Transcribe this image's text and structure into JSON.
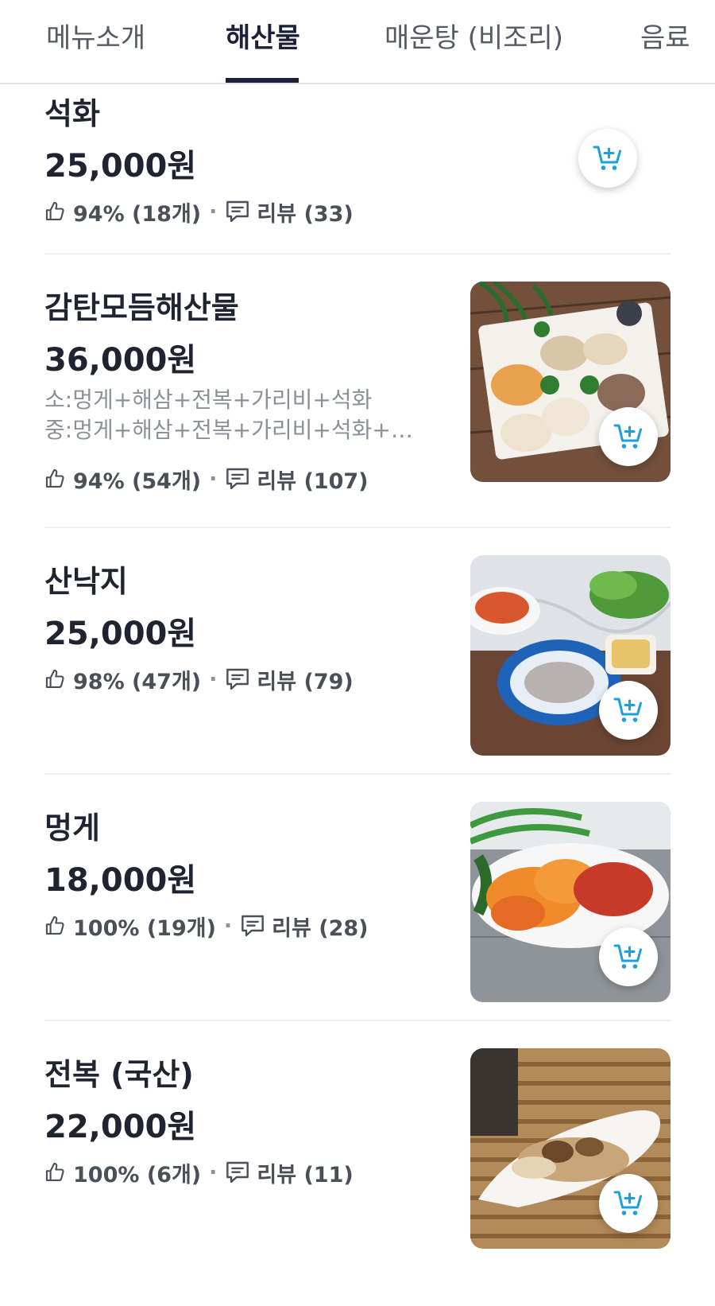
{
  "tabs": [
    {
      "label": "메뉴소개",
      "active": false
    },
    {
      "label": "해산물",
      "active": true
    },
    {
      "label": "매운탕 (비조리)",
      "active": false
    },
    {
      "label": "음료",
      "active": false
    }
  ],
  "items": [
    {
      "name": "석화",
      "price": "25,000원",
      "rating": "94% (18개)",
      "reviews": "리뷰 (33)"
    },
    {
      "name": "감탄모듬해산물",
      "price": "36,000원",
      "desc_line1": "소:멍게+해삼+전복+가리비+석화",
      "desc_line2": "중:멍게+해삼+전복+가리비+석화+멍게+해삼+전복",
      "rating": "94% (54개)",
      "reviews": "리뷰 (107)"
    },
    {
      "name": "산낙지",
      "price": "25,000원",
      "rating": "98% (47개)",
      "reviews": "리뷰 (79)"
    },
    {
      "name": "멍게",
      "price": "18,000원",
      "rating": "100% (19개)",
      "reviews": "리뷰 (28)"
    },
    {
      "name": "전복 (국산)",
      "price": "22,000원",
      "rating": "100% (6개)",
      "reviews": "리뷰 (11)"
    }
  ],
  "colors": {
    "accent": "#1c1f3a",
    "cart_icon": "#1aa0dc",
    "divider": "#eceef1"
  },
  "icons": {
    "like": "thumbs-up-icon",
    "review": "speech-bubble-icon",
    "cart": "add-to-cart-icon"
  }
}
